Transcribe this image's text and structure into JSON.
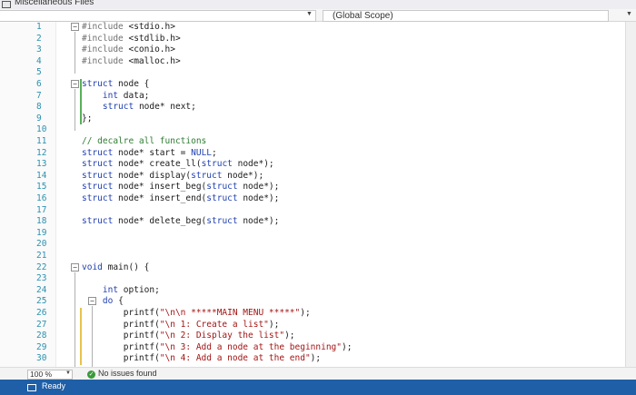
{
  "window": {
    "title": "Miscellaneous Files"
  },
  "navbar": {
    "project_dropdown": "",
    "scope_dropdown": "(Global Scope)"
  },
  "editor": {
    "lines": [
      {
        "n": "1",
        "code": "#include <stdio.h>"
      },
      {
        "n": "2",
        "code": "#include <stdlib.h>"
      },
      {
        "n": "3",
        "code": "#include <conio.h>"
      },
      {
        "n": "4",
        "code": "#include <malloc.h>"
      },
      {
        "n": "5",
        "code": ""
      },
      {
        "n": "6",
        "code": "struct node {"
      },
      {
        "n": "7",
        "code": "    int data;"
      },
      {
        "n": "8",
        "code": "    struct node* next;"
      },
      {
        "n": "9",
        "code": "};"
      },
      {
        "n": "10",
        "code": ""
      },
      {
        "n": "11",
        "code": "// decalre all functions"
      },
      {
        "n": "12",
        "code": "struct node* start = NULL;"
      },
      {
        "n": "13",
        "code": "struct node* create_ll(struct node*);"
      },
      {
        "n": "14",
        "code": "struct node* display(struct node*);"
      },
      {
        "n": "15",
        "code": "struct node* insert_beg(struct node*);"
      },
      {
        "n": "16",
        "code": "struct node* insert_end(struct node*);"
      },
      {
        "n": "17",
        "code": ""
      },
      {
        "n": "18",
        "code": "struct node* delete_beg(struct node*);"
      },
      {
        "n": "19",
        "code": ""
      },
      {
        "n": "20",
        "code": ""
      },
      {
        "n": "21",
        "code": ""
      },
      {
        "n": "22",
        "code": "void main() {"
      },
      {
        "n": "23",
        "code": ""
      },
      {
        "n": "24",
        "code": "    int option;"
      },
      {
        "n": "25",
        "code": "    do {"
      },
      {
        "n": "26",
        "code": "        printf(\"\\n\\n *****MAIN MENU *****\");"
      },
      {
        "n": "27",
        "code": "        printf(\"\\n 1: Create a list\");"
      },
      {
        "n": "28",
        "code": "        printf(\"\\n 2: Display the list\");"
      },
      {
        "n": "29",
        "code": "        printf(\"\\n 3: Add a node at the beginning\");"
      },
      {
        "n": "30",
        "code": "        printf(\"\\n 4: Add a node at the end\");"
      }
    ]
  },
  "status": {
    "zoom": "100 %",
    "issues": "No issues found",
    "ready": "Ready"
  },
  "icons": {
    "issues": "check-circle-icon",
    "file": "file-icon",
    "ready": "output-icon"
  },
  "colors": {
    "statusbar": "#1f5fa8",
    "keyword": "#1f3fb0",
    "linenumber": "#2b91af"
  }
}
